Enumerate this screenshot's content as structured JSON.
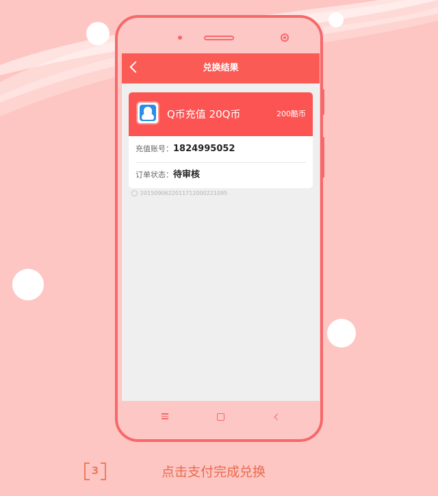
{
  "screen": {
    "title": "兑换结果",
    "product": {
      "name": "Q币充值 20Q币",
      "price": "200酷币",
      "icon": "qq-penguin-icon"
    },
    "account": {
      "label": "充值账号：",
      "value": "1824995052"
    },
    "status": {
      "label": "订单状态：",
      "value": "待审核"
    },
    "order_number": "2015090622011712000221095"
  },
  "nav_icons": [
    "menu-icon",
    "home-icon",
    "back-icon"
  ],
  "caption": {
    "step": "3",
    "text": "点击支付完成兑换"
  },
  "colors": {
    "background": "#fec6c2",
    "accent": "#fb5b55",
    "phone_outline": "#f6686a",
    "caption_text": "#e86a4f"
  }
}
